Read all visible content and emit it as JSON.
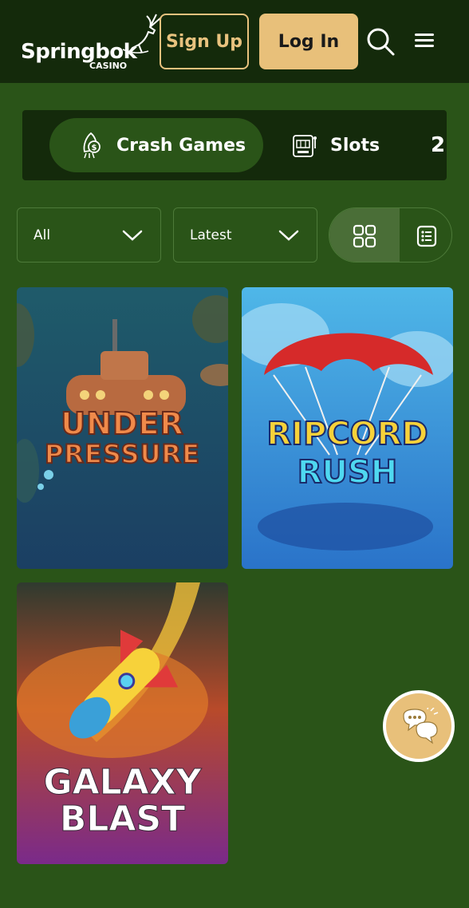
{
  "header": {
    "logo": {
      "brand": "Springbok",
      "sub": "CASINO"
    },
    "signup_label": "Sign Up",
    "login_label": "Log In",
    "icons": [
      "search-icon",
      "menu-icon"
    ]
  },
  "categories": {
    "items": [
      {
        "label": "Crash Games",
        "icon": "rocket-coin-icon",
        "active": true
      },
      {
        "label": "Slots",
        "icon": "slot-machine-icon",
        "active": false
      },
      {
        "label": "2",
        "icon": "",
        "active": false
      }
    ]
  },
  "filters": {
    "type": {
      "value": "All"
    },
    "sort": {
      "value": "Latest"
    },
    "view": {
      "selected": "grid",
      "options": [
        "grid",
        "list"
      ]
    }
  },
  "games": [
    {
      "title_line1": "UNDER",
      "title_line2": "PRESSURE"
    },
    {
      "title_line1": "RIPCORD",
      "title_line2": "RUSH"
    },
    {
      "title_line1": "GALAXY",
      "title_line2": "BLAST"
    }
  ],
  "colors": {
    "header_bg": "#142a0b",
    "page_bg": "#2a5418",
    "accent_gold": "#e8c07a"
  }
}
